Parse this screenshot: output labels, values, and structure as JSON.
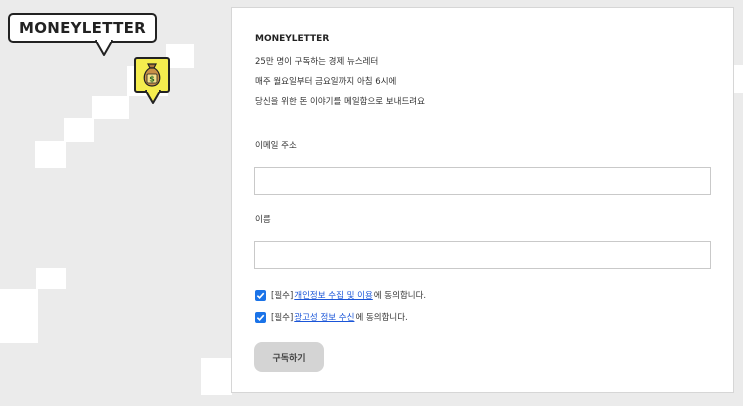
{
  "badge": {
    "text": "MONEYLETTER",
    "money_icon": "money-bag-icon",
    "money_color": "#f4ec4e"
  },
  "form": {
    "brand": "MONEYLETTER",
    "lines": [
      "25만 명이 구독하는 경제 뉴스레터",
      "매주 월요일부터 금요일까지 아침 6시에",
      "당신을 위한 돈 이야기를 메일함으로 보내드려요"
    ],
    "email_label": "이메일 주소",
    "email_value": "",
    "name_label": "이름",
    "name_value": "",
    "consent1": {
      "checked": true,
      "prefix": "[필수]",
      "link": "개인정보 수집 및 이용",
      "suffix": "에 동의합니다."
    },
    "consent2": {
      "checked": true,
      "prefix": "[필수]",
      "link": "광고성 정보 수신",
      "suffix": "에 동의합니다."
    },
    "submit_label": "구독하기",
    "accent_color": "#1a73e8"
  }
}
